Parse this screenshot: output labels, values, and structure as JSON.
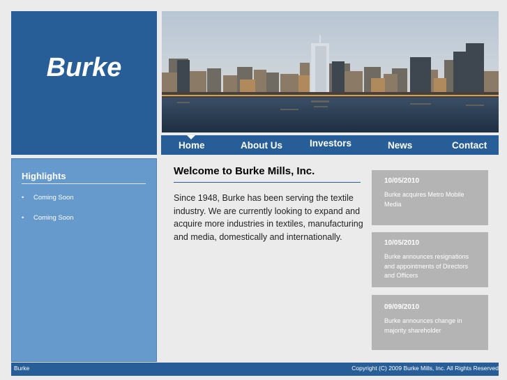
{
  "logo": {
    "text": "Burke"
  },
  "banner": {
    "image": "city-skyline-waterfront-photo"
  },
  "nav": {
    "items": [
      {
        "label": "Home",
        "active": true
      },
      {
        "label": "About Us"
      },
      {
        "label": "Investors"
      },
      {
        "label": "News"
      },
      {
        "label": "Contact"
      }
    ]
  },
  "sidebar": {
    "title": "Highlights",
    "items": [
      {
        "label": "Coming Soon"
      },
      {
        "label": "Coming Soon"
      }
    ]
  },
  "main": {
    "title": "Welcome to Burke Mills, Inc.",
    "intro": "Since 1948, Burke has been serving the textile industry. We are currently looking to expand and acquire more industries in textiles, manufacturing and media, domestically and internationally."
  },
  "news": [
    {
      "date": "10/05/2010",
      "text": "Burke acquires Metro Mobile Media"
    },
    {
      "date": "10/05/2010",
      "text": "Burke announces resignations and appointments of Directors and Officers"
    },
    {
      "date": "09/09/2010",
      "text": "Burke announces change in majority shareholder"
    }
  ],
  "footer": {
    "left": "Burke",
    "right": "Copyright (C) 2009 Burke Mills, Inc. All Rights Reserved"
  },
  "colors": {
    "brand_blue": "#285e98",
    "sidebar_blue": "#6699cc",
    "card_gray": "#b4b4b4",
    "page_bg": "#ebebeb"
  }
}
